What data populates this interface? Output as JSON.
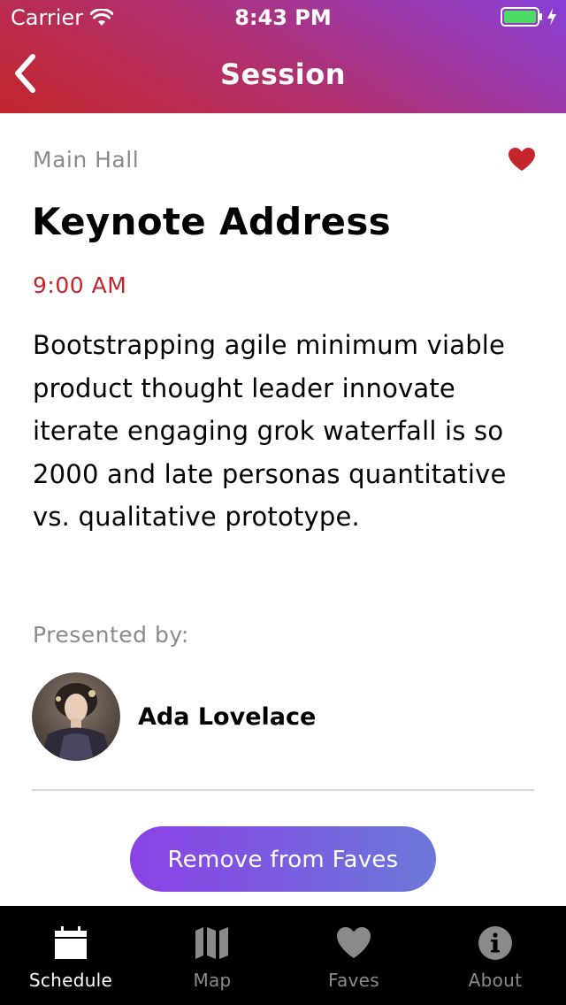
{
  "status_bar": {
    "carrier": "Carrier",
    "time": "8:43 PM"
  },
  "nav": {
    "title": "Session",
    "back_icon": "chevron-left-icon"
  },
  "session": {
    "location": "Main Hall",
    "title": "Keynote Address",
    "time": "9:00 AM",
    "description": "Bootstrapping agile minimum viable product thought leader innovate iterate engaging grok waterfall is so 2000 and late personas quantitative vs. qualitative prototype.",
    "is_fave": true
  },
  "presenters": {
    "label": "Presented by:",
    "items": [
      {
        "name": "Ada Lovelace"
      }
    ]
  },
  "actions": {
    "remove_fave_label": "Remove from Faves"
  },
  "tabs": [
    {
      "label": "Schedule",
      "icon": "calendar-icon",
      "active": true
    },
    {
      "label": "Map",
      "icon": "map-icon",
      "active": false
    },
    {
      "label": "Faves",
      "icon": "heart-icon",
      "active": false
    },
    {
      "label": "About",
      "icon": "info-icon",
      "active": false
    }
  ],
  "colors": {
    "header_start": "#c4262b",
    "header_end": "#8a3fd8",
    "accent_red": "#c4262b",
    "button_start": "#8a42e6",
    "button_end": "#6b78d9",
    "tab_bar_bg": "#000000",
    "tab_inactive": "#8a8a8a",
    "battery_fill": "#4cd964"
  }
}
